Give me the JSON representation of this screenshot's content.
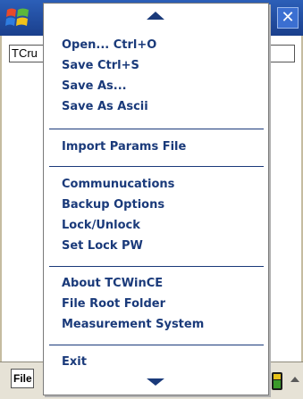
{
  "titlebar": {
    "start_icon": "windows-flag-icon",
    "close_label": "✕",
    "close_icon": "close-icon"
  },
  "app": {
    "field_text": "TCru",
    "file_button": "File"
  },
  "menu": {
    "items": [
      {
        "label": "Open...  Ctrl+O"
      },
      {
        "label": "Save  Ctrl+S"
      },
      {
        "label": "Save As..."
      },
      {
        "label": "Save As Ascii"
      },
      {
        "label": "Import Params File"
      },
      {
        "label": "Communucations"
      },
      {
        "label": "Backup Options"
      },
      {
        "label": "Lock/Unlock"
      },
      {
        "label": "Set Lock PW"
      },
      {
        "label": "About TCWinCE"
      },
      {
        "label": "File Root Folder"
      },
      {
        "label": "Measurement System"
      },
      {
        "label": "Exit"
      }
    ],
    "scroll_up_icon": "scroll-up-icon",
    "scroll_down_icon": "scroll-down-icon"
  },
  "tray": {
    "status_icon": "battery-status-icon",
    "up_arrow_icon": "tray-up-arrow-icon"
  },
  "colors": {
    "titlebar": "#2c5fb8",
    "menu_text": "#1a3a7a",
    "bottombar": "#e6e2d6"
  }
}
